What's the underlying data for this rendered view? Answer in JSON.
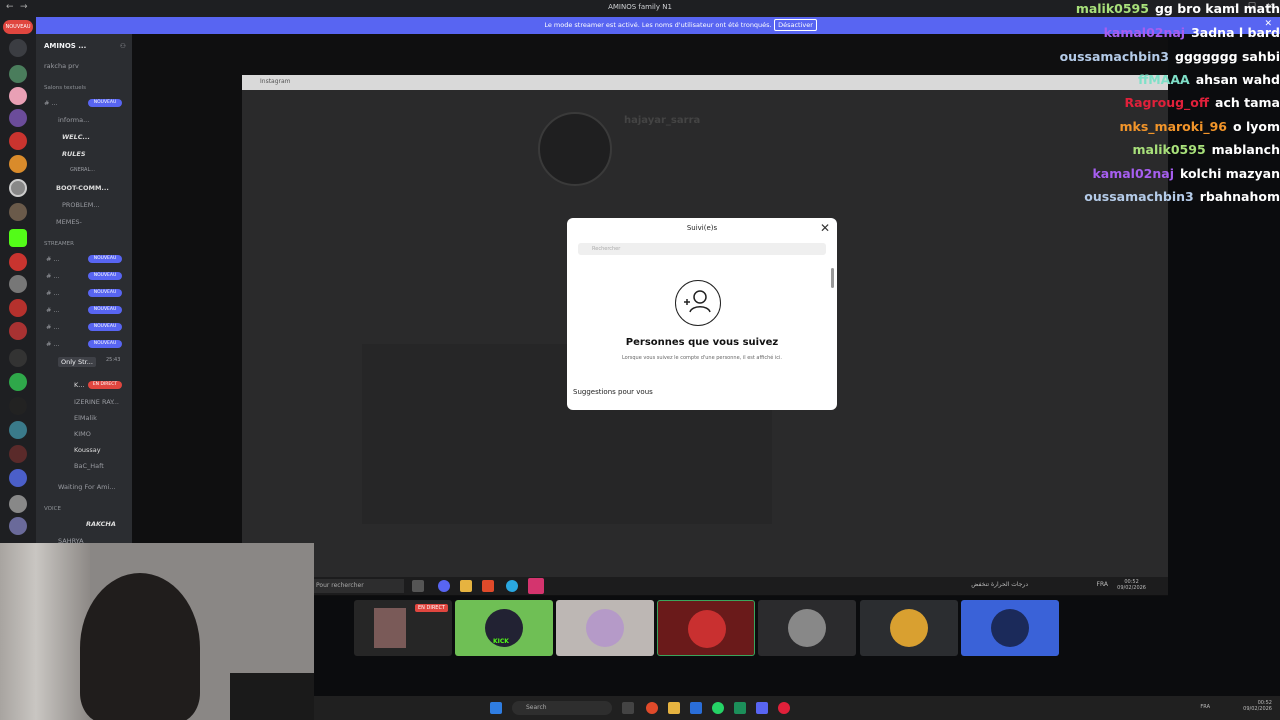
{
  "window": {
    "title": "AMINOS family N1"
  },
  "banner": {
    "message": "Le mode streamer est activé. Les noms d'utilisateur ont été tronqués.",
    "button": "Désactiver"
  },
  "rail": {
    "new_badge": "NOUVEAU"
  },
  "sidebar": {
    "server_name": "AMINOS ...",
    "items": [
      {
        "label": "rakcha prv"
      },
      {
        "label": "Salons textuels"
      },
      {
        "label": "# ..."
      },
      {
        "label": "informa..."
      },
      {
        "label": "WELC..."
      },
      {
        "label": "RULES"
      },
      {
        "label": "GNERAL..."
      },
      {
        "label": "BOOT-COMM..."
      },
      {
        "label": "PROBLEM..."
      },
      {
        "label": "MEMES-"
      },
      {
        "label": "STREAMER"
      },
      {
        "label": "# ..."
      },
      {
        "label": "# ..."
      },
      {
        "label": "# ..."
      },
      {
        "label": "# ..."
      },
      {
        "label": "# ..."
      },
      {
        "label": "# ..."
      },
      {
        "label": "Only Str..."
      },
      {
        "label": "K..."
      },
      {
        "label": "IZERINE RAY..."
      },
      {
        "label": "ElMalik"
      },
      {
        "label": "KIMO"
      },
      {
        "label": "Koussay"
      },
      {
        "label": "BaC_Haft"
      },
      {
        "label": "Waiting For Ami..."
      },
      {
        "label": "VOICE"
      },
      {
        "label": "RAKCHA"
      },
      {
        "label": "SAHRYA"
      }
    ],
    "new_badge": "NOUVEAU",
    "live_badge": "EN DIRECT",
    "time": "25:43"
  },
  "instagram": {
    "window_title": "Instagram",
    "profile_name": "hajayar_sarra",
    "dialog": {
      "title": "Suivi(e)s",
      "search_placeholder": "Rechercher",
      "heading": "Personnes que vous suivez",
      "subtext": "Lorsque vous suivez le compte d'une personne, il est affiché ici.",
      "suggestions": "Suggestions pour vous"
    }
  },
  "chat": [
    {
      "user": "malik0595",
      "color": "#a8e07a",
      "msg": "gg bro kaml math"
    },
    {
      "user": "kamal02naj",
      "color": "#a65ef0",
      "msg": "3adna l bard"
    },
    {
      "user": "oussamachbin3",
      "color": "#b4cbe8",
      "msg": "ggggggg sahbi"
    },
    {
      "user": "ffMAAA",
      "color": "#7fe0c8",
      "msg": "ahsan wahd"
    },
    {
      "user": "Ragroug_off",
      "color": "#e0203a",
      "msg": "ach tama"
    },
    {
      "user": "mks_maroki_96",
      "color": "#f2952a",
      "msg": "o lyom"
    },
    {
      "user": "malik0595",
      "color": "#a8e07a",
      "msg": "mablanch"
    },
    {
      "user": "kamal02naj",
      "color": "#a65ef0",
      "msg": "kolchi mazyan"
    },
    {
      "user": "oussamachbin3",
      "color": "#b4cbe8",
      "msg": "rbahnahom"
    }
  ],
  "inner_taskbar": {
    "search": "Pour rechercher",
    "weather": "درجات الحرارة تنخفض",
    "lang": "FRA",
    "time": "00:52",
    "date": "09/02/2026"
  },
  "participants": {
    "live_badge": "EN DIRECT",
    "kick_label": "KICK"
  },
  "taskbar": {
    "search": "Search",
    "lang": "FRA",
    "time": "00:52",
    "date": "09/02/2026"
  }
}
